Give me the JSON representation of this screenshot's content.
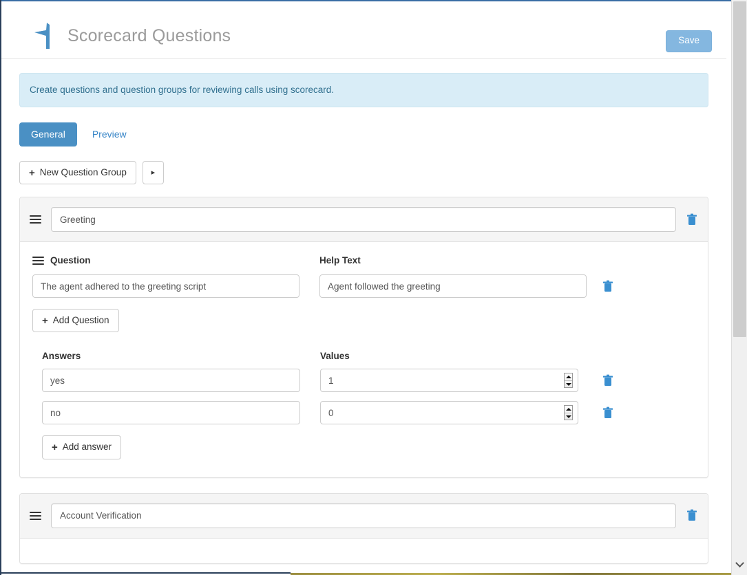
{
  "header": {
    "title": "Scorecard Questions",
    "logo_icon": "star-flag-logo",
    "save_label": "Save"
  },
  "banner": {
    "text": "Create questions and question groups for reviewing calls using scorecard."
  },
  "tabs": [
    {
      "label": "General",
      "active": true
    },
    {
      "label": "Preview",
      "active": false
    }
  ],
  "toolbar": {
    "new_group_label": "New Question Group",
    "plus_glyph": "+",
    "caret_glyph": "▸"
  },
  "groups": [
    {
      "name_value": "Greeting",
      "grip_icon": "drag-handle-icon",
      "delete_icon": "trash-icon",
      "labels": {
        "question": "Question",
        "help_text": "Help Text",
        "answers": "Answers",
        "values": "Values"
      },
      "questions": [
        {
          "question_value": "The agent adhered to the greeting script",
          "help_value": "Agent followed the greeting"
        }
      ],
      "add_question_label": "Add Question",
      "answers": [
        {
          "answer_value": "yes",
          "value_value": "1"
        },
        {
          "answer_value": "no",
          "value_value": "0"
        }
      ],
      "add_answer_label": "Add answer"
    },
    {
      "name_value": "Account Verification",
      "grip_icon": "drag-handle-icon",
      "delete_icon": "trash-icon"
    }
  ],
  "scrollbar": {
    "down_arrow_icon": "chevron-down-icon"
  },
  "colors": {
    "primary_blue": "#4a90c4",
    "save_blue": "#84b7e0",
    "link_blue": "#3a87c8",
    "banner_bg": "#d9edf7",
    "banner_text": "#31708f",
    "trash_blue": "#3a8fd0"
  }
}
